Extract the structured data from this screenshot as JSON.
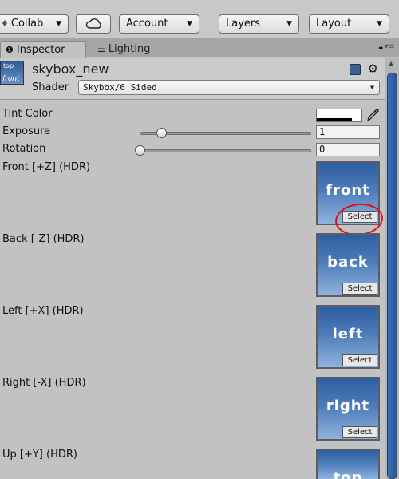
{
  "toolbar": {
    "collab_label": "Collab",
    "collab_icon": "diamond-icon",
    "cloud_icon": "cloud-icon",
    "account_label": "Account",
    "layers_label": "Layers",
    "layout_label": "Layout"
  },
  "tabs": {
    "inspector_label": "Inspector",
    "lighting_label": "Lighting"
  },
  "material": {
    "name": "skybox_new",
    "thumb_top": "top",
    "thumb_bottom": "front",
    "shader_label": "Shader",
    "shader_value": "Skybox/6 Sided"
  },
  "properties": {
    "tint_label": "Tint Color",
    "tint_color": "#ffffff",
    "exposure_label": "Exposure",
    "exposure_value": "1",
    "exposure_fraction": 0.125,
    "rotation_label": "Rotation",
    "rotation_value": "0",
    "rotation_fraction": 0.0
  },
  "textures": [
    {
      "label": "Front [+Z]   (HDR)",
      "thumb_text": "front",
      "select_label": "Select"
    },
    {
      "label": "Back [-Z]   (HDR)",
      "thumb_text": "back",
      "select_label": "Select"
    },
    {
      "label": "Left [+X]   (HDR)",
      "thumb_text": "left",
      "select_label": "Select"
    },
    {
      "label": "Right [-X]   (HDR)",
      "thumb_text": "right",
      "select_label": "Select"
    },
    {
      "label": "Up [+Y]   (HDR)",
      "thumb_text": "top",
      "select_label": "Select"
    }
  ],
  "colors": {
    "annotation": "#e01010",
    "scroll_thumb": "#3d6fb6",
    "texture_sky": "#4e7cba"
  }
}
